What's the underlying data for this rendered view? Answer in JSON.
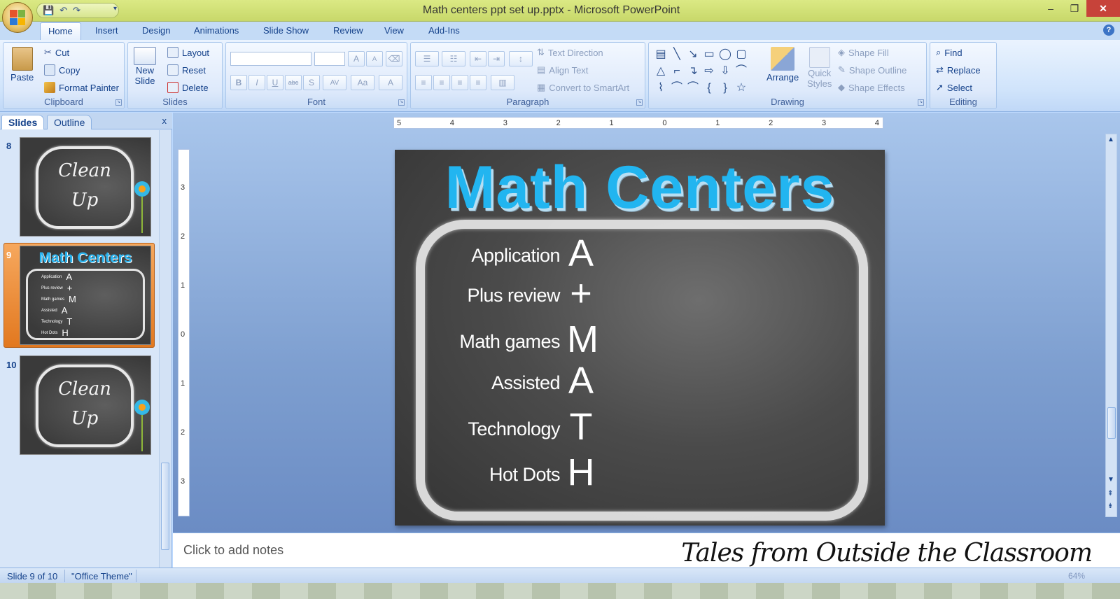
{
  "window": {
    "title": "Math centers ppt set up.pptx - Microsoft PowerPoint",
    "controls": [
      "–",
      "❐",
      "✕"
    ]
  },
  "qat": {
    "save": "💾",
    "undo": "↶",
    "redo": "↷",
    "more": "▾"
  },
  "tabs": [
    "Home",
    "Insert",
    "Design",
    "Animations",
    "Slide Show",
    "Review",
    "View",
    "Add-Ins"
  ],
  "help": "?",
  "ribbon": {
    "clipboard": {
      "name": "Clipboard",
      "paste": "Paste",
      "cut": "Cut",
      "copy": "Copy",
      "format_painter": "Format Painter"
    },
    "slides": {
      "name": "Slides",
      "new_slide": "New",
      "new_slide2": "Slide",
      "layout": "Layout",
      "reset": "Reset",
      "delete": "Delete"
    },
    "font": {
      "name": "Font",
      "grow": "A",
      "shrink": "A",
      "bold": "B",
      "italic": "I",
      "underline": "U",
      "strike": "abc",
      "shadow": "S",
      "spacing": "AV",
      "case": "Aa",
      "color": "A"
    },
    "paragraph": {
      "name": "Paragraph",
      "text_direction": "Text Direction",
      "align_text": "Align Text",
      "convert_smartart": "Convert to SmartArt"
    },
    "drawing": {
      "name": "Drawing",
      "arrange": "Arrange",
      "quick": "Quick",
      "styles": "Styles",
      "shape_fill": "Shape Fill",
      "shape_outline": "Shape Outline",
      "shape_effects": "Shape Effects",
      "shapes": [
        "▤",
        "╲",
        "↘",
        "▭",
        "◯",
        "▢",
        "△",
        "⌐",
        "↴",
        "⇨",
        "⇩",
        "⌒",
        "⌇",
        "⌒",
        "⌒",
        "{",
        "}",
        "☆"
      ]
    },
    "editing": {
      "name": "Editing",
      "find": "Find",
      "replace": "Replace",
      "select": "Select"
    }
  },
  "panel": {
    "tab_slides": "Slides",
    "tab_outline": "Outline",
    "close": "x",
    "thumbs": [
      {
        "num": "8",
        "line1": "Clean",
        "line2": "Up"
      },
      {
        "num": "9",
        "title": "Math Centers",
        "rows": [
          [
            "Application",
            "A"
          ],
          [
            "Plus review",
            "+"
          ],
          [
            "Math games",
            "M"
          ],
          [
            "Assisted",
            "A"
          ],
          [
            "Technology",
            "T"
          ],
          [
            "Hot Dots",
            "H"
          ]
        ]
      },
      {
        "num": "10",
        "line1": "Clean",
        "line2": "Up"
      }
    ]
  },
  "ruler": {
    "h": [
      "5",
      "4",
      "3",
      "2",
      "1",
      "0",
      "1",
      "2",
      "3",
      "4"
    ],
    "v": [
      "3",
      "2",
      "1",
      "0",
      "1",
      "2",
      "3"
    ]
  },
  "slide": {
    "title": "Math Centers",
    "rows": [
      {
        "label": "Application",
        "letter": "A"
      },
      {
        "label": "Plus review",
        "letter": "+"
      },
      {
        "label": "Math games",
        "letter": "M"
      },
      {
        "label": "Assisted",
        "letter": "A"
      },
      {
        "label": "Technology",
        "letter": "T"
      },
      {
        "label": "Hot Dots",
        "letter": "H"
      }
    ]
  },
  "notes": {
    "placeholder": "Click to add notes"
  },
  "watermark": "Tales from Outside the Classroom",
  "status": {
    "slide": "Slide 9 of 10",
    "theme": "\"Office Theme\"",
    "zoom": "64%"
  },
  "colors": {
    "accent": "#22b5f0",
    "chalkboard": "#4b4b4b",
    "selection": "#e2781f"
  }
}
